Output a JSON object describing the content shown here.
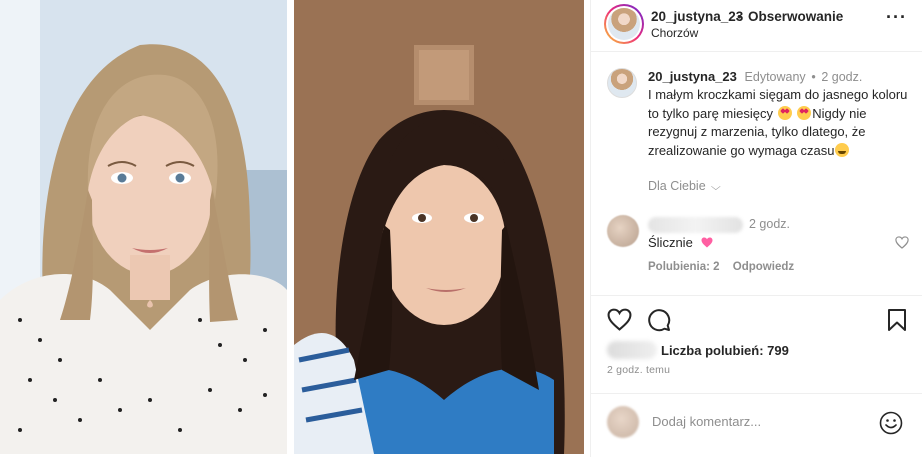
{
  "post": {
    "username": "20_justyna_23",
    "separator": "•",
    "follow_status": "Obserwowanie",
    "location": "Chorzów",
    "more_label": "···"
  },
  "caption": {
    "username": "20_justyna_23",
    "edited": "Edytowany",
    "separator": "•",
    "time": "2 godz.",
    "text_part1": "I małym kroczkami sięgam do jasnego koloru to tylko parę miesięcy",
    "text_part2": "Nigdy nie rezygnuj z marzenia, tylko dlatego, że zrealizowanie go wymaga czasu",
    "emoji_1": "heart-eyes-emoji",
    "emoji_2": "heart-eyes-emoji",
    "emoji_3": "grin-emoji"
  },
  "for_you": {
    "label": "Dla Ciebie",
    "chevron": "⌵"
  },
  "comment": {
    "time": "2 godz.",
    "text": "Ślicznie",
    "likes": "Polubienia: 2",
    "reply": "Odpowiedz"
  },
  "actions": {
    "like_icon": "heart-icon",
    "comment_icon": "comment-bubble-icon",
    "save_icon": "bookmark-icon"
  },
  "likes_text": "Liczba polubień: 799",
  "time_ago": "2 godz. temu",
  "add_comment": {
    "placeholder": "Dodaj komentarz...",
    "emoji_icon": "smiley-icon"
  },
  "colors": {
    "text": "#262626",
    "secondary": "#8e8e8e",
    "border": "#efefef",
    "heart_pink": "#e0245e"
  }
}
